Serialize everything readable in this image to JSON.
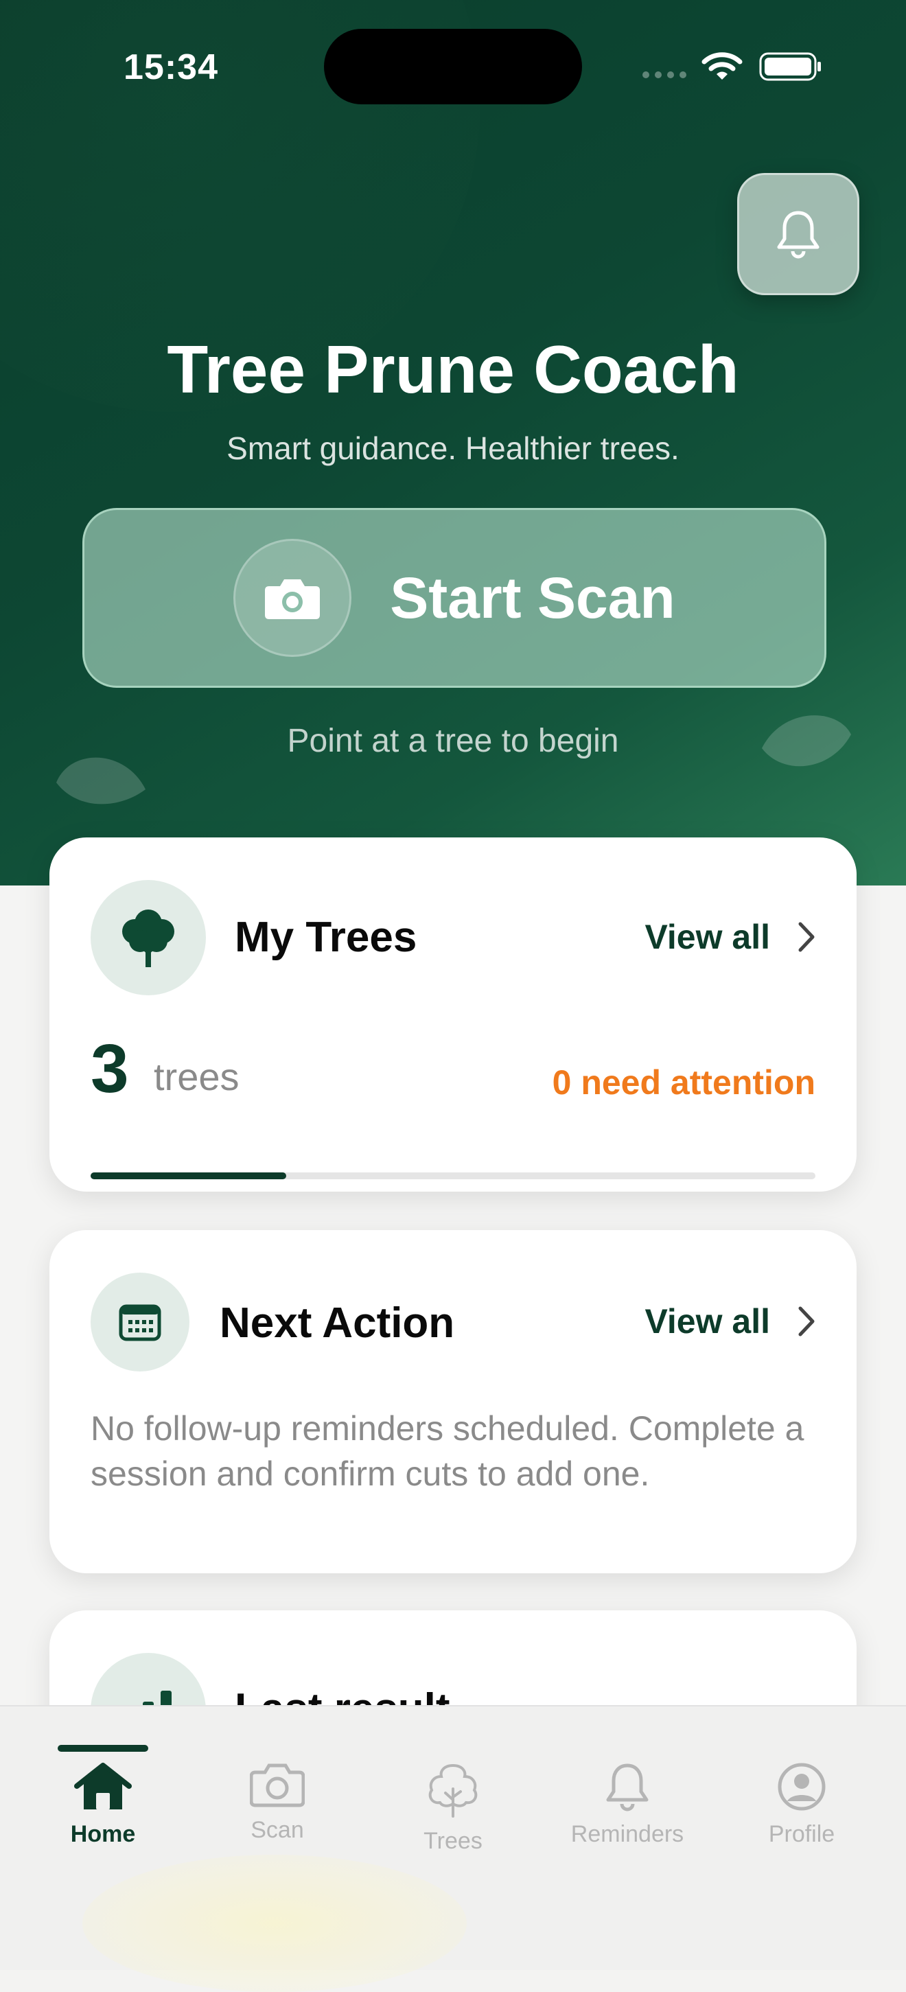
{
  "status": {
    "time": "15:34"
  },
  "header": {
    "title": "Tree Prune Coach",
    "subtitle": "Smart guidance. Healthier trees.",
    "scan_label": "Start Scan",
    "hint": "Point at a tree to begin"
  },
  "my_trees": {
    "title": "My Trees",
    "view_all": "View all",
    "count": "3",
    "unit": "trees",
    "attention": "0 need attention",
    "progress_fraction": 0.27
  },
  "next_action": {
    "title": "Next Action",
    "view_all": "View all",
    "text": "No follow-up reminders scheduled. Complete a session and confirm cuts to add one."
  },
  "last_result": {
    "title": "Last result"
  },
  "tabs": [
    {
      "label": "Home",
      "icon": "house-icon",
      "active": true
    },
    {
      "label": "Scan",
      "icon": "camera-icon",
      "active": false
    },
    {
      "label": "Trees",
      "icon": "tree-icon",
      "active": false
    },
    {
      "label": "Reminders",
      "icon": "bell-icon",
      "active": false
    },
    {
      "label": "Profile",
      "icon": "person-icon",
      "active": false
    }
  ],
  "colors": {
    "primary": "#0d3b2a",
    "attention": "#f07a1c"
  }
}
